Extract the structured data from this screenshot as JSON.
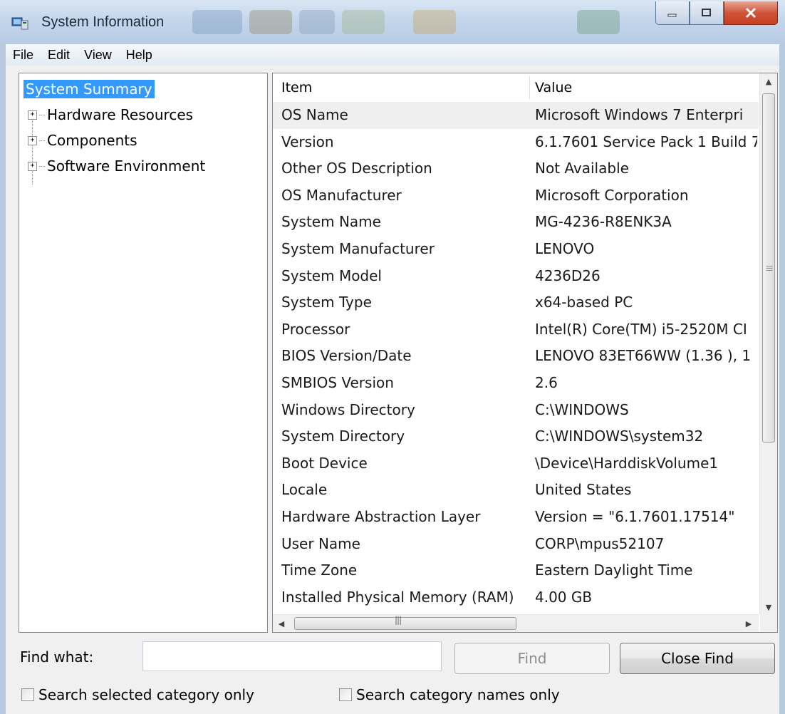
{
  "window": {
    "title": "System Information"
  },
  "caption": {
    "minimize": "—",
    "maximize": "☐",
    "close": "✕"
  },
  "menu": [
    "File",
    "Edit",
    "View",
    "Help"
  ],
  "tree": {
    "items": [
      {
        "label": "System Summary",
        "selected": true,
        "expandable": false
      },
      {
        "label": "Hardware Resources",
        "selected": false,
        "expandable": true
      },
      {
        "label": "Components",
        "selected": false,
        "expandable": true
      },
      {
        "label": "Software Environment",
        "selected": false,
        "expandable": true
      }
    ]
  },
  "list": {
    "columns": [
      "Item",
      "Value"
    ],
    "rows": [
      [
        "OS Name",
        "Microsoft Windows 7 Enterpri"
      ],
      [
        "Version",
        "6.1.7601 Service Pack 1 Build 7"
      ],
      [
        "Other OS Description",
        "Not Available"
      ],
      [
        "OS Manufacturer",
        "Microsoft Corporation"
      ],
      [
        "System Name",
        "MG-4236-R8ENK3A"
      ],
      [
        "System Manufacturer",
        "LENOVO"
      ],
      [
        "System Model",
        "4236D26"
      ],
      [
        "System Type",
        "x64-based PC"
      ],
      [
        "Processor",
        "Intel(R) Core(TM) i5-2520M CI"
      ],
      [
        "BIOS Version/Date",
        "LENOVO 83ET66WW (1.36 ), 1"
      ],
      [
        "SMBIOS Version",
        "2.6"
      ],
      [
        "Windows Directory",
        "C:\\WINDOWS"
      ],
      [
        "System Directory",
        "C:\\WINDOWS\\system32"
      ],
      [
        "Boot Device",
        "\\Device\\HarddiskVolume1"
      ],
      [
        "Locale",
        "United States"
      ],
      [
        "Hardware Abstraction Layer",
        "Version = \"6.1.7601.17514\""
      ],
      [
        "User Name",
        "CORP\\mpus52107"
      ],
      [
        "Time Zone",
        "Eastern Daylight Time"
      ],
      [
        "Installed Physical Memory (RAM)",
        "4.00 GB"
      ]
    ]
  },
  "find": {
    "label": "Find what:",
    "value": "",
    "find_button": "Find",
    "close_button": "Close Find",
    "search_selected": "Search selected category only",
    "search_names": "Search category names only"
  },
  "colors": {
    "selection": "#3399ff",
    "title_bar": "#c4d6eb",
    "close_button": "#c6401f"
  }
}
